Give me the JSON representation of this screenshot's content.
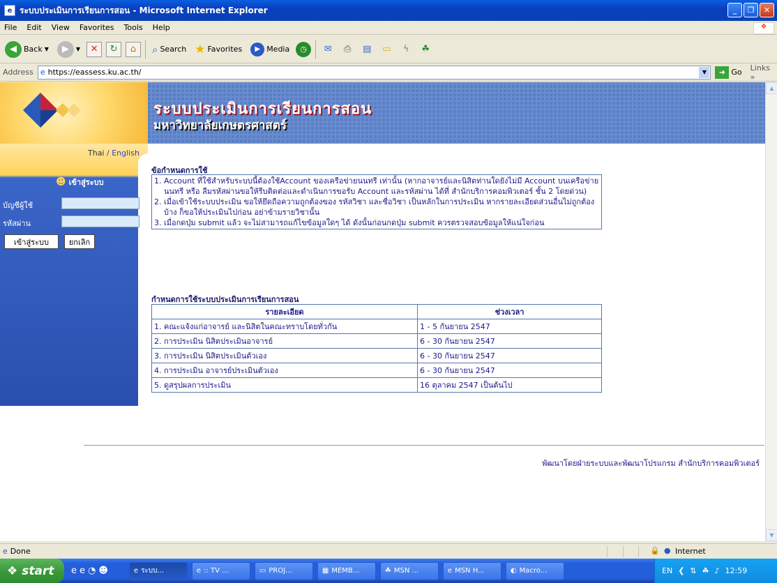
{
  "window": {
    "title": "ระบบประเมินการเรียนการสอน - Microsoft Internet Explorer"
  },
  "menu": [
    "File",
    "Edit",
    "View",
    "Favorites",
    "Tools",
    "Help"
  ],
  "toolbar": {
    "back": "Back",
    "search": "Search",
    "favorites": "Favorites",
    "media": "Media"
  },
  "address": {
    "label": "Address",
    "url": "https://eassess.ku.ac.th/",
    "go": "Go",
    "links": "Links"
  },
  "banner": {
    "title": "ระบบประเมินการเรียนการสอน",
    "subtitle": "มหาวิทยาลัยเกษตรศาสตร์"
  },
  "langs": {
    "thai": "Thai",
    "sep": "/",
    "english": "English"
  },
  "login": {
    "heading": "เข้าสู่ระบบ",
    "user_label": "บัญชีผู้ใช้",
    "pass_label": "รหัสผ่าน",
    "submit": "เข้าสู่ระบบ",
    "cancel": "ยกเลิก"
  },
  "rules": {
    "title": "ข้อกำหนดการใช้",
    "items": [
      {
        "n": "1.",
        "text": "Account ที่ใช้สำหรับระบบนี้ต้องใช้Account ของเครือข่ายนนทรี เท่านั้น (หากอาจารย์และนิสิตท่านใดยังไม่มี Account บนเครือข่ายนนทรี หรือ ลืมรหัสผ่านขอให้รีบติดต่อและดำเนินการขอรับ Account และรหัสผ่าน ได้ที่ สำนักบริการคอมพิวเตอร์ ชั้น 2 โดยด่วน)"
      },
      {
        "n": "2.",
        "text": "เมื่อเข้าใช้ระบบประเมิน ขอให้ยึดถือความถูกต้องของ รหัสวิชา และชื่อวิชา เป็นหลักในการประเมิน หากรายละเอียดส่วนอื่นไม่ถูกต้องบ้าง ก็ขอให้ประเมินไปก่อน อย่าข้ามรายวิชานั้น"
      },
      {
        "n": "3.",
        "text": "เมื่อกดปุ่ม submit แล้ว จะไม่สามารถแก้ไขข้อมูลใดๆ ได้ ดังนั้นก่อนกดปุ่ม submit ควรตรวจสอบข้อมูลให้แน่ใจก่อน"
      }
    ]
  },
  "schedule": {
    "title": "กำหนดการใช้ระบบประเมินการเรียนการสอน",
    "col_detail": "รายละเอียด",
    "col_period": "ช่วงเวลา",
    "rows": [
      {
        "detail": "1. คณะแจ้งแก่อาจารย์ และนิสิตในคณะทราบโดยทั่วกัน",
        "period": "1 - 5 กันยายน 2547"
      },
      {
        "detail": "2. การประเมิน นิสิตประเมินอาจารย์",
        "period": "6 - 30 กันยายน 2547"
      },
      {
        "detail": "3. การประเมิน นิสิตประเมินตัวเอง",
        "period": "6 - 30 กันยายน 2547"
      },
      {
        "detail": "4. การประเมิน อาจารย์ประเมินตัวเอง",
        "period": "6 - 30 กันยายน 2547"
      },
      {
        "detail": "5. ดูสรุปผลการประเมิน",
        "period": "16 ตุลาคม 2547 เป็นต้นไป"
      }
    ]
  },
  "footer": "พัฒนาโดยฝ่ายระบบและพัฒนาโปรแกรม สำนักบริการคอมพิวเตอร์",
  "status": {
    "text": "Done",
    "zone": "Internet"
  },
  "taskbar": {
    "start": "start",
    "tasks": [
      "ระบบ...",
      ":: TV ...",
      "PROJ...",
      "MEMB...",
      "MSN ...",
      "MSN H...",
      "Macro..."
    ],
    "lang": "EN",
    "clock": "12:59"
  }
}
